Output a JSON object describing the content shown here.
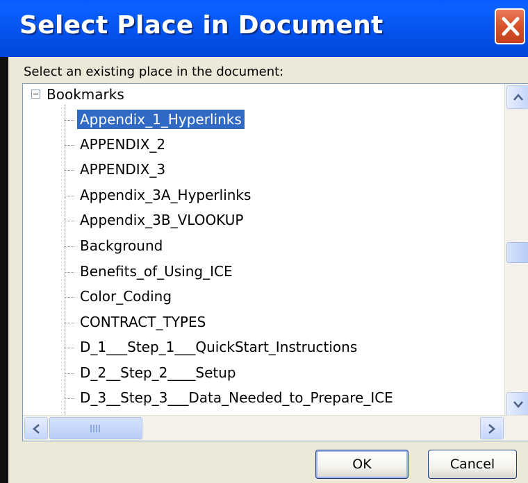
{
  "window": {
    "title": "Select Place in Document"
  },
  "dialog": {
    "prompt": "Select an existing place in the document:",
    "tree": {
      "root": "Bookmarks",
      "items": [
        "Appendix_1_Hyperlinks",
        "APPENDIX_2",
        "APPENDIX_3",
        "Appendix_3A_Hyperlinks",
        "Appendix_3B_VLOOKUP",
        "Background",
        "Benefits_of_Using_ICE",
        "Color_Coding",
        "CONTRACT_TYPES",
        "D_1___Step_1___QuickStart_Instructions",
        "D_2__Step_2____Setup",
        "D_3__Step_3___Data_Needed_to_Prepare_ICE"
      ],
      "selected": "Appendix_1_Hyperlinks"
    },
    "buttons": {
      "ok": "OK",
      "cancel": "Cancel"
    }
  },
  "icons": {
    "close": "close-icon",
    "scroll_up": "chevron-up-icon",
    "scroll_down": "chevron-down-icon",
    "scroll_left": "chevron-left-icon",
    "scroll_right": "chevron-right-icon",
    "collapse": "minus-box-icon"
  },
  "colors": {
    "titlebar": "#0a5bff",
    "selection": "#316ac5",
    "close": "#d9512a"
  }
}
